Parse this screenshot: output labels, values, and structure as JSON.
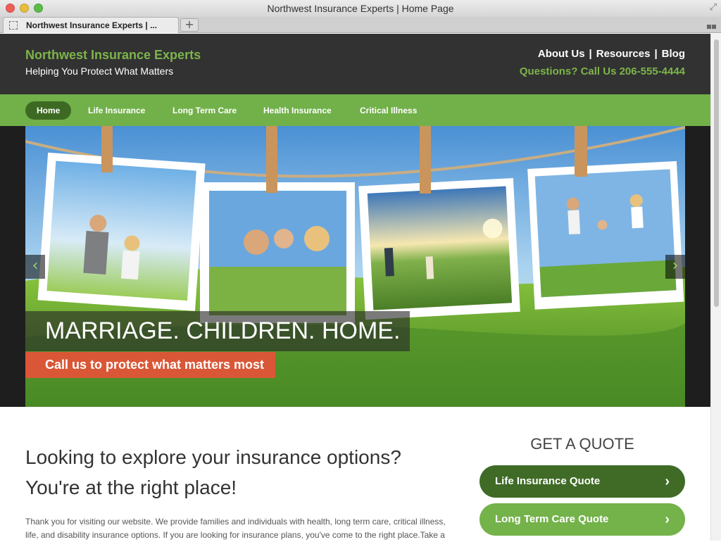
{
  "window": {
    "title": "Northwest Insurance Experts | Home Page"
  },
  "browser": {
    "tab_title": "Northwest Insurance Experts | ...",
    "new_tab_label": "+"
  },
  "header": {
    "site_name": "Northwest Insurance Experts",
    "tagline": "Helping You Protect What Matters",
    "links": [
      "About Us",
      "Resources",
      "Blog"
    ],
    "separator": "|",
    "phone_text": "Questions? Call Us 206-555-4444"
  },
  "nav": {
    "items": [
      "Home",
      "Life Insurance",
      "Long Term Care",
      "Health Insurance",
      "Critical Illness"
    ],
    "active": "Home"
  },
  "hero": {
    "title": "MARRIAGE. CHILDREN. HOME.",
    "subtitle": "Call us to protect what matters most",
    "prev_icon": "‹",
    "next_icon": "›"
  },
  "main": {
    "headline": "Looking to explore your insurance options? You're at the right place!",
    "body": "Thank you for visiting our website. We provide families and individuals with health, long term care, critical illness, life, and disability insurance options. If you are looking for insurance plans, you've come to the right place.Take a"
  },
  "quote": {
    "title": "GET A QUOTE",
    "buttons": [
      {
        "label": "Life Insurance Quote",
        "icon": "›"
      },
      {
        "label": "Long Term Care Quote",
        "icon": "›"
      }
    ]
  },
  "colors": {
    "header_bg": "#323232",
    "brand_green": "#72b04a",
    "dark_green": "#3d6a22",
    "accent_orange": "#d95737"
  }
}
